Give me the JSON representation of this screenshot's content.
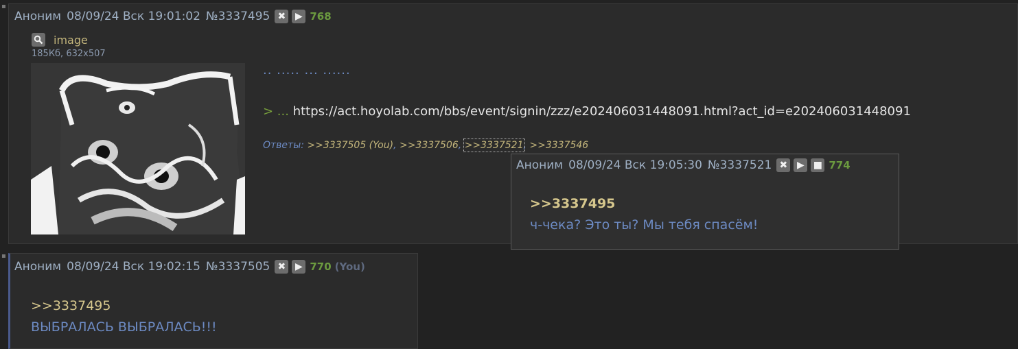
{
  "post1": {
    "author": "Аноним",
    "date": "08/09/24 Вск 19:01:02",
    "number": "№3337495",
    "likes": "768",
    "file": {
      "name": "image",
      "meta": "185Кб, 632x507"
    },
    "dots_line": ".. ..... ... ......",
    "greentext_prefix": "> ...",
    "greentext_url": "https://act.hoyolab.com/bbs/event/signin/zzz/e202406031448091.html?act_id=e202406031448091",
    "replies_label": "Ответы:",
    "replies": [
      {
        "text": ">>3337505 (You)"
      },
      {
        "text": ">>3337506"
      },
      {
        "text": ">>3337521"
      },
      {
        "text": ">>3337546"
      }
    ]
  },
  "popup": {
    "author": "Аноним",
    "date": "08/09/24 Вск 19:05:30",
    "number": "№3337521",
    "likes": "774",
    "quote": ">>3337495",
    "text": "ч-чека? Это ты? Мы тебя спасём!"
  },
  "post2": {
    "author": "Аноним",
    "date": "08/09/24 Вск 19:02:15",
    "number": "№3337505",
    "likes": "770",
    "you": "(You)",
    "quote": ">>3337495",
    "text": "ВЫБРАЛАСЬ ВЫБРАЛАСЬ!!!"
  },
  "icons": {
    "hide": "close-icon",
    "play": "play-icon",
    "stop": "stop-icon",
    "search": "magnifier-icon"
  },
  "colors": {
    "background": "#222222",
    "post_bg": "#2b2b2b",
    "link": "#c4b67c",
    "text_blue": "#6d8bc4",
    "likes": "#6b9a3f",
    "greentext": "#78a03c"
  }
}
